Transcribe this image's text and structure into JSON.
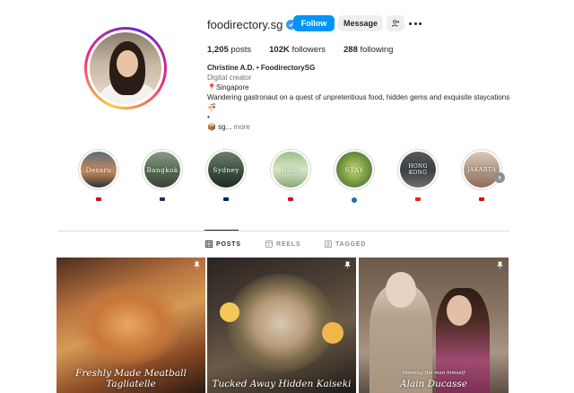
{
  "profile": {
    "username": "foodirectory.sg",
    "follow_label": "Follow",
    "message_label": "Message",
    "stats": {
      "posts": "1,205",
      "posts_label": "posts",
      "followers": "102K",
      "followers_label": "followers",
      "following": "288",
      "following_label": "following"
    },
    "bio": {
      "name": "Christine A.D. • FoodirectorySG",
      "category": "Digital creator",
      "location": "📍Singapore",
      "description": "Wandering gastronaut on a quest of unpretentious food, hidden gems and exquisite staycations",
      "line_emoji": "🍜",
      "line_dot": "•",
      "link_prefix": "📦 sg...",
      "more_label": "more"
    }
  },
  "highlights": [
    {
      "title": "Desaru",
      "flag_color": "#c8102e"
    },
    {
      "title": "Bangkok",
      "flag_color": "#2d2a4a"
    },
    {
      "title": "Sydney",
      "flag_color": "#012169"
    },
    {
      "title": "BALI",
      "flag_color": "#ce1126"
    },
    {
      "title": "STAY",
      "flag_color": "#1f6fb2"
    },
    {
      "title": "HONG KONG",
      "flag_color": "#de2910"
    },
    {
      "title": "JAKARTA",
      "flag_color": "#ce1126"
    }
  ],
  "tabs": [
    {
      "label": "POSTS",
      "active": true
    },
    {
      "label": "REELS",
      "active": false
    },
    {
      "label": "TAGGED",
      "active": false
    }
  ],
  "posts": [
    {
      "caption": "Freshly Made Meatball Tagliatelle",
      "pinned": true
    },
    {
      "caption": "Tucked Away Hidden Kaiseki",
      "pinned": true
    },
    {
      "caption": "Alain Ducasse",
      "subtext": "Meeting the man himself",
      "pinned": true
    }
  ],
  "colors": {
    "accent": "#0095f6",
    "verified": "#3897f0",
    "secondary_text": "#737373"
  }
}
